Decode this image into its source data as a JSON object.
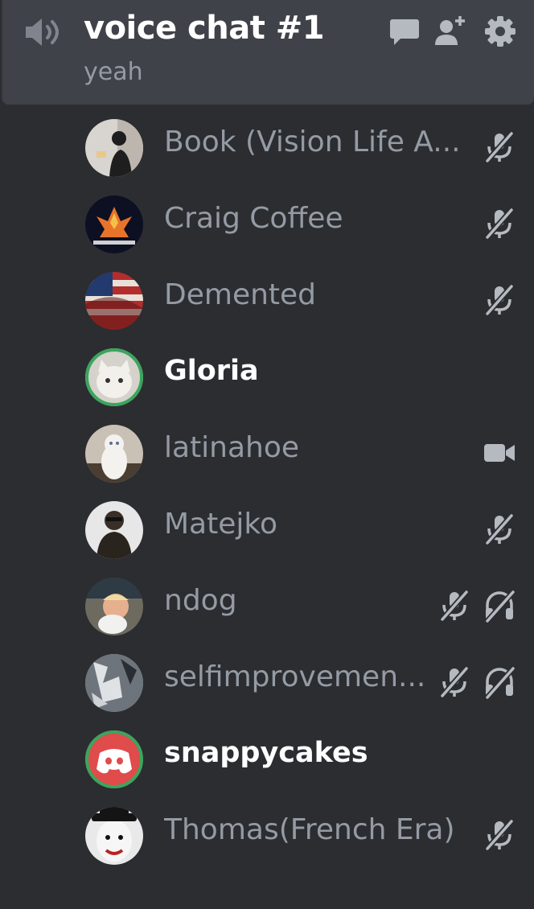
{
  "channel": {
    "name": "voice chat #1",
    "status": "yeah"
  },
  "header_icons": [
    "speaker-icon",
    "chat-bubble-icon",
    "add-user-icon",
    "gear-icon"
  ],
  "colors": {
    "background": "#2b2d31",
    "header": "#404249",
    "muted_text": "#949ba4",
    "active_text": "#ffffff",
    "speaking_ring": "#3ba55d"
  },
  "users": [
    {
      "name": "Book (Vision Life A...",
      "muted": true,
      "deafened": false,
      "video": false,
      "speaking": false
    },
    {
      "name": "Craig Coffee",
      "muted": true,
      "deafened": false,
      "video": false,
      "speaking": false
    },
    {
      "name": "Demented",
      "muted": true,
      "deafened": false,
      "video": false,
      "speaking": false
    },
    {
      "name": "Gloria",
      "muted": false,
      "deafened": false,
      "video": false,
      "speaking": true
    },
    {
      "name": "latinahoe",
      "muted": false,
      "deafened": false,
      "video": true,
      "speaking": false
    },
    {
      "name": "Matejko",
      "muted": true,
      "deafened": false,
      "video": false,
      "speaking": false
    },
    {
      "name": "ndog",
      "muted": true,
      "deafened": true,
      "video": false,
      "speaking": false
    },
    {
      "name": "selfimprovemen...",
      "muted": true,
      "deafened": true,
      "video": false,
      "speaking": false
    },
    {
      "name": "snappycakes",
      "muted": false,
      "deafened": false,
      "video": false,
      "speaking": true
    },
    {
      "name": "Thomas(French Era)",
      "muted": true,
      "deafened": false,
      "video": false,
      "speaking": false
    }
  ]
}
